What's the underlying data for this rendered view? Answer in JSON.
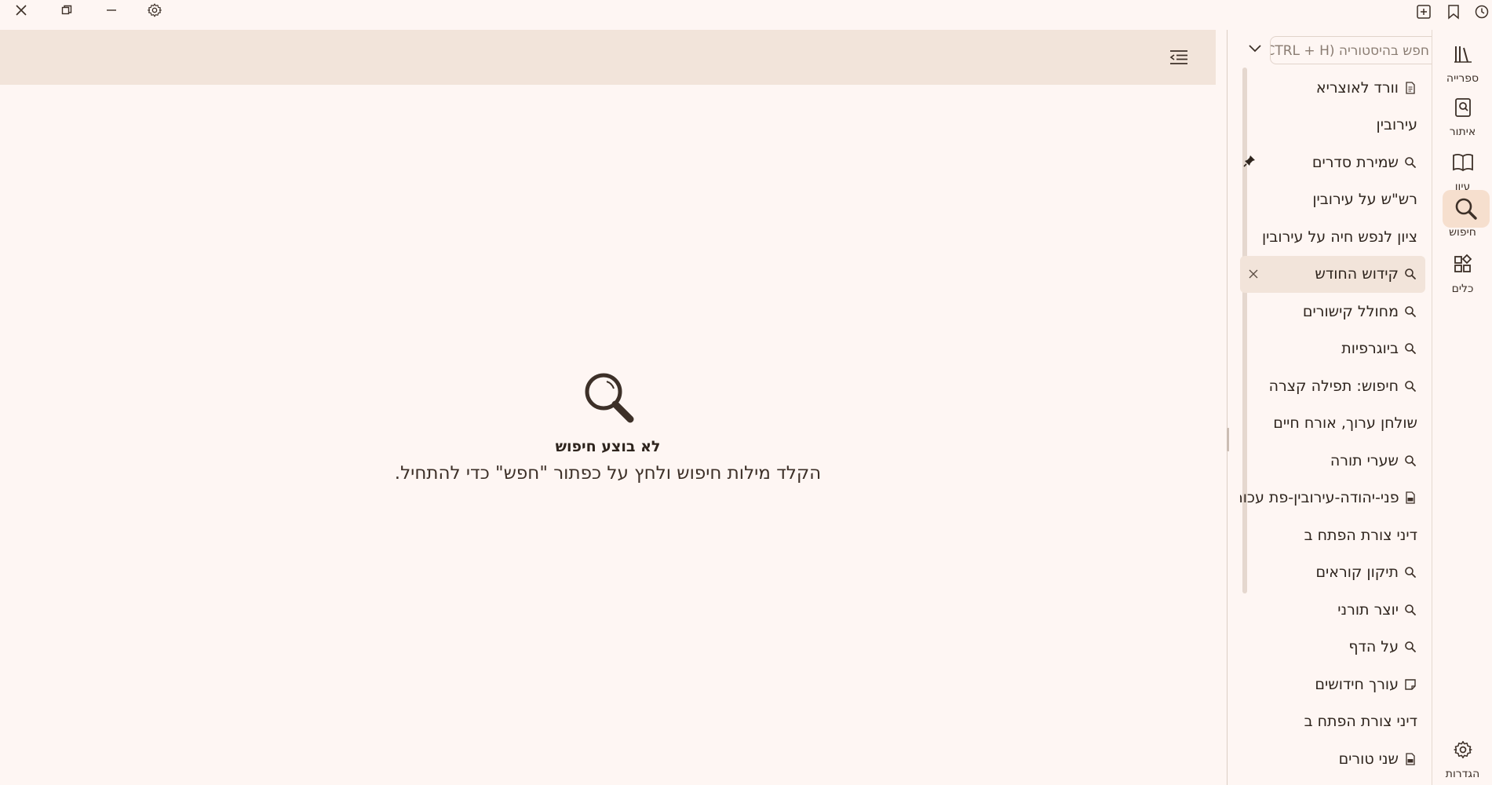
{
  "window": {
    "close_label": "close",
    "restore_label": "restore",
    "minimize_label": "minimize",
    "settings_label": "settings"
  },
  "main": {
    "empty_title": "לא בוצע חיפוש",
    "empty_subtitle": "הקלד מילות חיפוש ולחץ על כפתור \"חפש\" כדי להתחיל."
  },
  "history": {
    "search_placeholder": "חפש בהיסטוריה (CTRL + H)",
    "items": [
      {
        "label": "וורד לאוצריא",
        "icon": "document-icon"
      },
      {
        "label": "עירובין",
        "icon": ""
      },
      {
        "label": "שמירת סדרים",
        "icon": "search-icon",
        "pinned": true
      },
      {
        "label": "רש\"ש על עירובין",
        "icon": ""
      },
      {
        "label": "ציון לנפש חיה על עירובין",
        "icon": ""
      },
      {
        "label": "קידוש החודש",
        "icon": "search-icon",
        "active": true
      },
      {
        "label": "מחולל קישורים",
        "icon": "search-icon"
      },
      {
        "label": "ביוגרפיות",
        "icon": "search-icon"
      },
      {
        "label": "חיפוש: תפילה קצרה",
        "icon": "search-icon"
      },
      {
        "label": "שולחן ערוך, אורח חיים",
        "icon": ""
      },
      {
        "label": "שערי תורה",
        "icon": "search-icon"
      },
      {
        "label": "פני-יהודה-עירובין-פת עכור",
        "icon": "pdf-icon"
      },
      {
        "label": "דיני צורת הפתח ב",
        "icon": ""
      },
      {
        "label": "תיקון קוראים",
        "icon": "search-icon"
      },
      {
        "label": "יוצר תורני",
        "icon": "search-icon"
      },
      {
        "label": "על הדף",
        "icon": "search-icon"
      },
      {
        "label": "עורך חידושים",
        "icon": "note-icon"
      },
      {
        "label": "דיני צורת הפתח ב",
        "icon": ""
      },
      {
        "label": "שני טורים",
        "icon": "pdf-icon"
      }
    ]
  },
  "rail": {
    "items": [
      {
        "label": "ספרייה",
        "icon": "library-icon"
      },
      {
        "label": "איתור",
        "icon": "find-book-icon"
      },
      {
        "label": "עיון",
        "icon": "open-book-icon"
      },
      {
        "label": "חיפוש",
        "icon": "search-icon",
        "active": true
      },
      {
        "label": "כלים",
        "icon": "tools-icon"
      }
    ],
    "settings_label": "הגדרות"
  },
  "colors": {
    "background": "#fef6f3",
    "topbar": "#f2e4da",
    "active_rail": "#f6dfce",
    "text": "#2e241d"
  }
}
